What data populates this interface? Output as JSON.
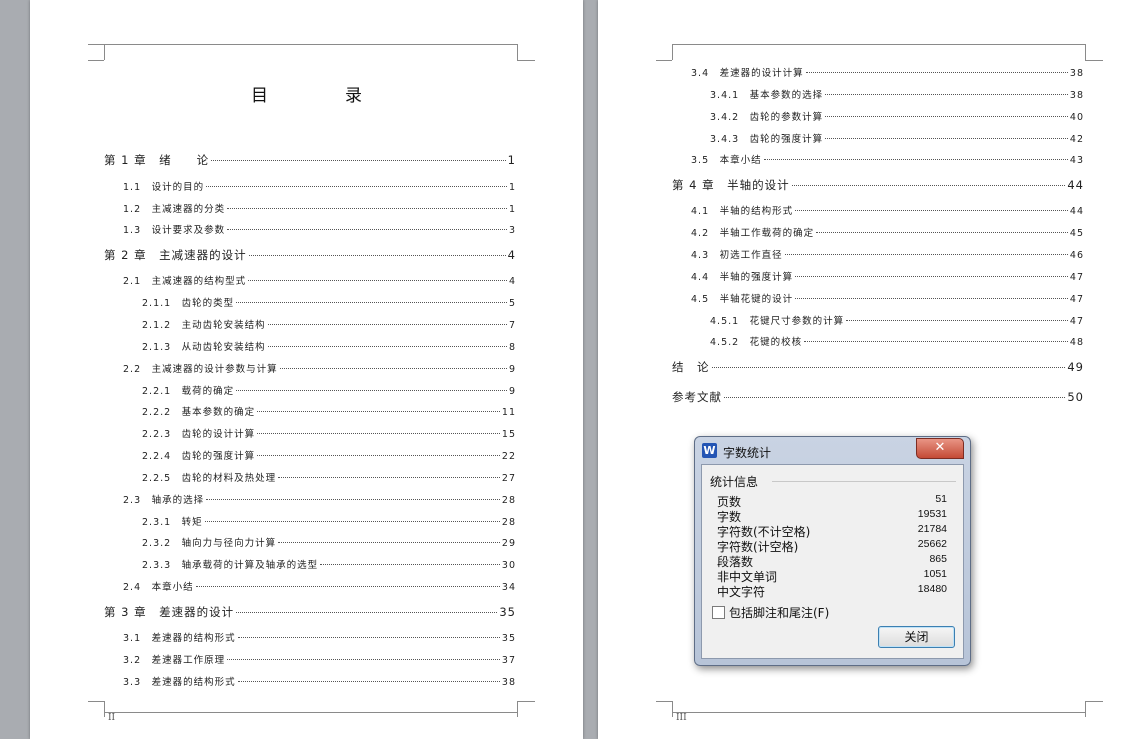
{
  "left_page": {
    "title": "目　录",
    "footer_page": "II",
    "entries": [
      {
        "level": 1,
        "title": "第 1 章　绪　　论",
        "page": "1"
      },
      {
        "level": 2,
        "title": "1.1　设计的目的",
        "page": "1"
      },
      {
        "level": 2,
        "title": "1.2　主减速器的分类",
        "page": "1"
      },
      {
        "level": 2,
        "title": "1.3　设计要求及参数",
        "page": "3"
      },
      {
        "level": 1,
        "title": "第 2 章　主减速器的设计",
        "page": "4"
      },
      {
        "level": 2,
        "title": "2.1　主减速器的结构型式",
        "page": "4"
      },
      {
        "level": 3,
        "title": "2.1.1　齿轮的类型",
        "page": "5"
      },
      {
        "level": 3,
        "title": "2.1.2　主动齿轮安装结构",
        "page": "7"
      },
      {
        "level": 3,
        "title": "2.1.3　从动齿轮安装结构",
        "page": "8"
      },
      {
        "level": 2,
        "title": "2.2　主减速器的设计参数与计算",
        "page": "9"
      },
      {
        "level": 3,
        "title": "2.2.1　载荷的确定",
        "page": "9"
      },
      {
        "level": 3,
        "title": "2.2.2　基本参数的确定",
        "page": "11"
      },
      {
        "level": 3,
        "title": "2.2.3　齿轮的设计计算",
        "page": "15"
      },
      {
        "level": 3,
        "title": "2.2.4　齿轮的强度计算",
        "page": "22"
      },
      {
        "level": 3,
        "title": "2.2.5　齿轮的材料及热处理",
        "page": "27"
      },
      {
        "level": 2,
        "title": "2.3　轴承的选择",
        "page": "28"
      },
      {
        "level": 3,
        "title": "2.3.1　转矩",
        "page": "28"
      },
      {
        "level": 3,
        "title": "2.3.2　轴向力与径向力计算",
        "page": "29"
      },
      {
        "level": 3,
        "title": "2.3.3　轴承载荷的计算及轴承的选型",
        "page": "30"
      },
      {
        "level": 2,
        "title": "2.4　本章小结",
        "page": "34"
      },
      {
        "level": 1,
        "title": "第 3 章　差速器的设计",
        "page": "35"
      },
      {
        "level": 2,
        "title": "3.1　差速器的结构形式",
        "page": "35"
      },
      {
        "level": 2,
        "title": "3.2　差速器工作原理",
        "page": "37"
      },
      {
        "level": 2,
        "title": "3.3　差速器的结构形式",
        "page": "38"
      }
    ]
  },
  "right_page": {
    "footer_page": "III",
    "entries": [
      {
        "level": 2,
        "title": "3.4　差速器的设计计算",
        "page": "38"
      },
      {
        "level": 3,
        "title": "3.4.1　基本参数的选择",
        "page": "38"
      },
      {
        "level": 3,
        "title": "3.4.2　齿轮的参数计算",
        "page": "40"
      },
      {
        "level": 3,
        "title": "3.4.3　齿轮的强度计算",
        "page": "42"
      },
      {
        "level": 2,
        "title": "3.5　本章小结",
        "page": "43"
      },
      {
        "level": 1,
        "title": "第 4 章　半轴的设计",
        "page": "44"
      },
      {
        "level": 2,
        "title": "4.1　半轴的结构形式",
        "page": "44"
      },
      {
        "level": 2,
        "title": "4.2　半轴工作载荷的确定",
        "page": "45"
      },
      {
        "level": 2,
        "title": "4.3　初选工作直径",
        "page": "46"
      },
      {
        "level": 2,
        "title": "4.4　半轴的强度计算",
        "page": "47"
      },
      {
        "level": 2,
        "title": "4.5　半轴花键的设计",
        "page": "47"
      },
      {
        "level": 3,
        "title": "4.5.1　花键尺寸参数的计算",
        "page": "47"
      },
      {
        "level": 3,
        "title": "4.5.2　花键的校核",
        "page": "48"
      },
      {
        "level": 1,
        "title": "结　论",
        "page": "49"
      },
      {
        "level": 1,
        "title": "参考文献",
        "page": "50"
      }
    ]
  },
  "dialog": {
    "icon_letter": "W",
    "title": "字数统计",
    "close_glyph": "✕",
    "group_label": "统计信息",
    "stats": [
      {
        "label": "页数",
        "value": "51"
      },
      {
        "label": "字数",
        "value": "19531"
      },
      {
        "label": "字符数(不计空格)",
        "value": "21784"
      },
      {
        "label": "字符数(计空格)",
        "value": "25662"
      },
      {
        "label": "段落数",
        "value": "865"
      },
      {
        "label": "非中文单词",
        "value": "1051"
      },
      {
        "label": "中文字符",
        "value": "18480"
      }
    ],
    "footnote_checkbox_label": "包括脚注和尾注(F)",
    "footnote_checked": false,
    "close_button_label": "关闭"
  }
}
